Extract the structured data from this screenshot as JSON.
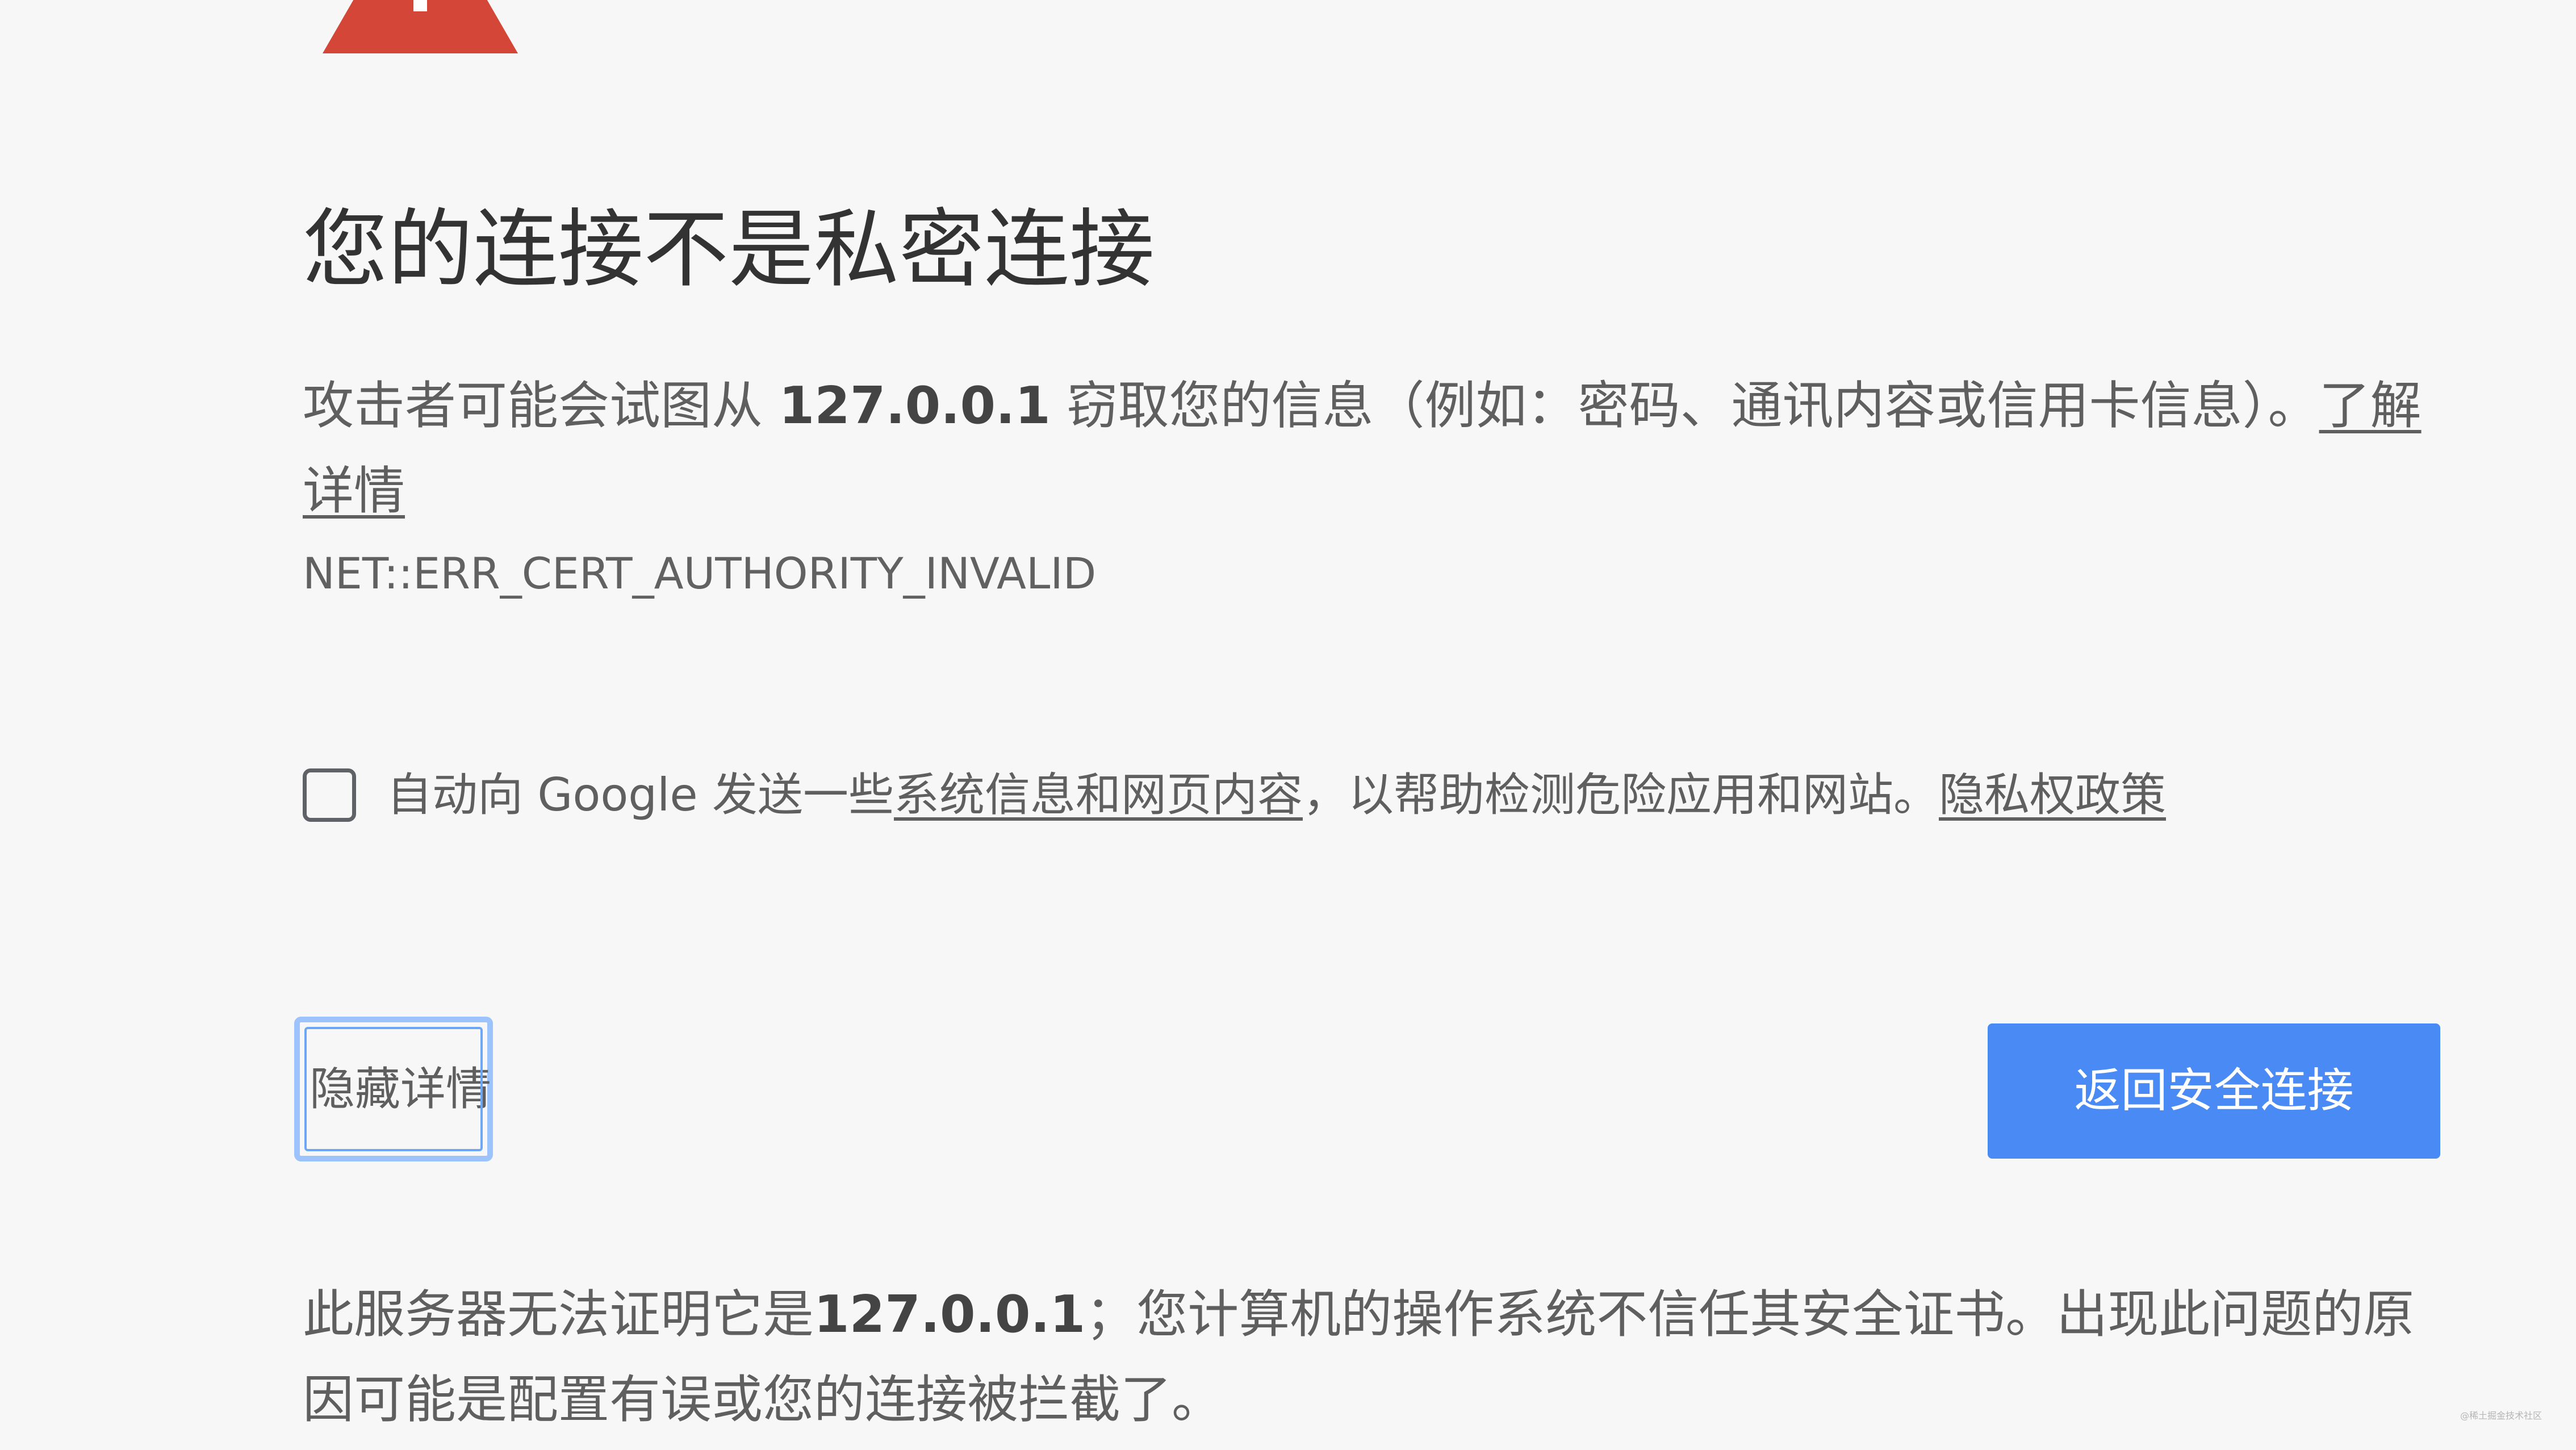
{
  "heading": "您的连接不是私密连接",
  "explanation": {
    "prefix": "攻击者可能会试图从 ",
    "host": "127.0.0.1",
    "suffix": " 窃取您的信息（例如：密码、通讯内容或信用卡信息）。",
    "learn_more": "了解详情"
  },
  "error_code": "NET::ERR_CERT_AUTHORITY_INVALID",
  "optin": {
    "checked": false,
    "prefix": "自动向 Google 发送一些",
    "link": "系统信息和网页内容",
    "middle": "，以帮助检测危险应用和网站。",
    "privacy_link": "隐私权政策"
  },
  "buttons": {
    "details_label": "隐藏详情",
    "primary_label": "返回安全连接"
  },
  "details": {
    "prefix": "此服务器无法证明它是",
    "host": "127.0.0.1",
    "suffix": "；您计算机的操作系统不信任其安全证书。出现此问题的原因可能是配置有误或您的连接被拦截了。"
  },
  "watermark": "@稀土掘金技术社区",
  "colors": {
    "background": "#f7f7f7",
    "warning_red": "#d44638",
    "primary_blue": "#4a8af4",
    "focus_ring": "#9cc3fb"
  },
  "icons": {
    "warning": "warning-triangle-icon",
    "checkbox": "checkbox-unchecked"
  }
}
